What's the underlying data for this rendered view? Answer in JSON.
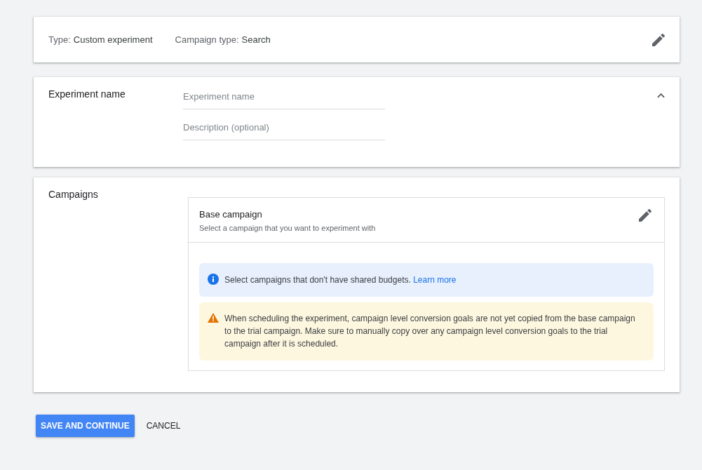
{
  "summary": {
    "items": [
      {
        "label": "Type:",
        "value": "Custom experiment"
      },
      {
        "label": "Campaign type:",
        "value": "Search"
      }
    ]
  },
  "name_section": {
    "title": "Experiment name",
    "expanded": true,
    "fields": [
      {
        "placeholder": "Experiment name"
      },
      {
        "placeholder": "Description (optional)"
      }
    ]
  },
  "campaigns_section": {
    "title": "Campaigns",
    "base_campaign": {
      "title": "Base campaign",
      "subtitle": "Select a campaign that you want to experiment with"
    },
    "alerts": [
      {
        "kind": "info",
        "text": "Select campaigns that don't have shared budgets.",
        "link": "Learn more"
      },
      {
        "kind": "warning",
        "text": "When scheduling the experiment, campaign level conversion goals are not yet copied from the base campaign to the trial campaign. Make sure to manually copy over any campaign level conversion goals to the trial campaign after it is scheduled."
      }
    ]
  },
  "buttons": [
    {
      "kind": "primary",
      "label": "SAVE AND CONTINUE"
    },
    {
      "kind": "text",
      "label": "CANCEL"
    }
  ]
}
